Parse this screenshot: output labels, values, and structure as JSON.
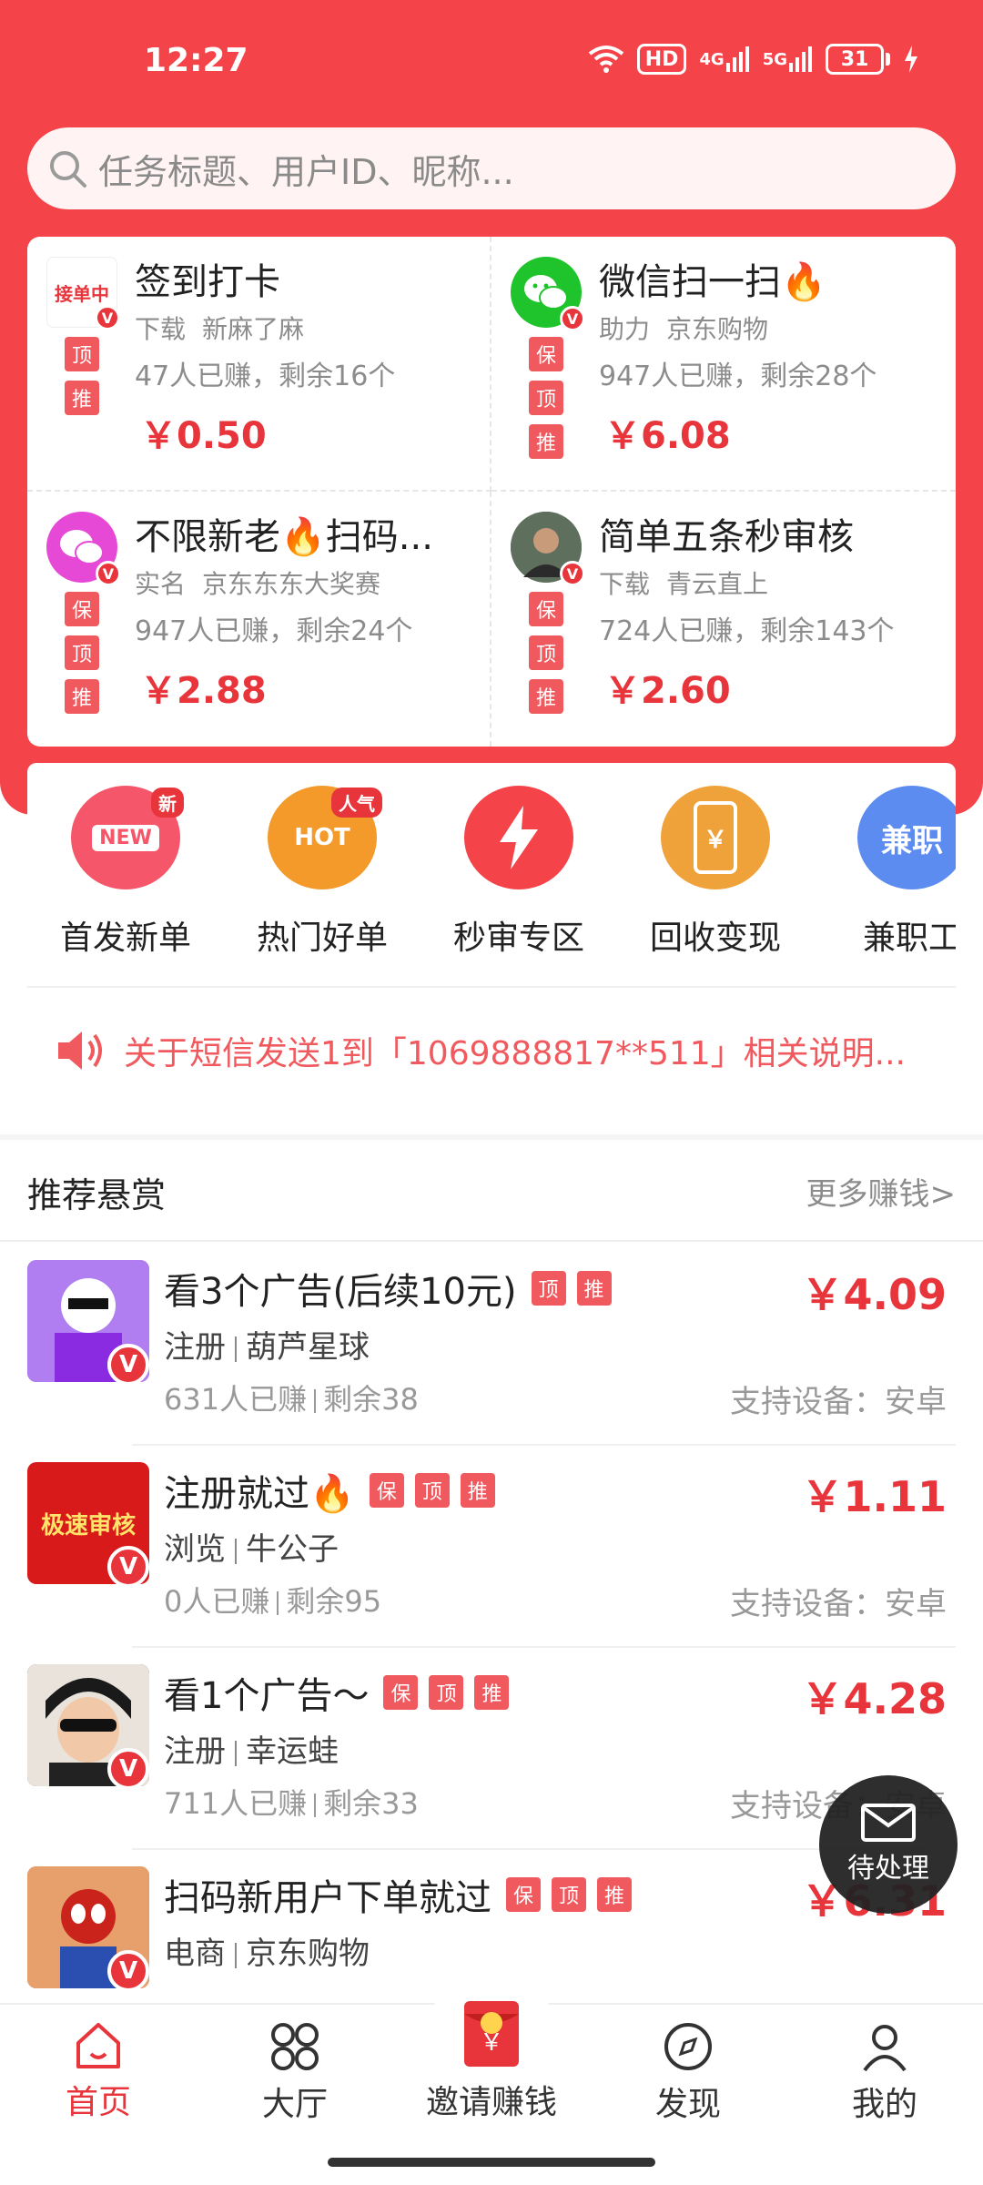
{
  "status": {
    "time": "12:27",
    "hd": "HD",
    "net1": "4G",
    "net2": "5G",
    "battery": "31"
  },
  "search": {
    "placeholder": "任务标题、用户ID、昵称..."
  },
  "top_tasks": [
    {
      "title": "签到打卡",
      "type": "下载",
      "user": "新麻了麻",
      "count": "47人已赚，剩余16个",
      "price": "￥0.50",
      "tags": [
        "顶",
        "推"
      ],
      "avatar_text": "接单中"
    },
    {
      "title": "微信扫一扫🔥",
      "type": "助力",
      "user": "京东购物",
      "count": "947人已赚，剩余28个",
      "price": "￥6.08",
      "tags": [
        "保",
        "顶",
        "推"
      ]
    },
    {
      "title": "不限新老🔥扫码...",
      "type": "实名",
      "user": "京东东东大奖赛",
      "count": "947人已赚，剩余24个",
      "price": "￥2.88",
      "tags": [
        "保",
        "顶",
        "推"
      ]
    },
    {
      "title": "简单五条秒审核",
      "type": "下载",
      "user": "青云直上",
      "count": "724人已赚，剩余143个",
      "price": "￥2.60",
      "tags": [
        "保",
        "顶",
        "推"
      ]
    }
  ],
  "categories": [
    {
      "label": "首发新单",
      "badge": "新",
      "icon_text": "NEW",
      "color": "#f5566a"
    },
    {
      "label": "热门好单",
      "badge": "人气",
      "icon_text": "HOT",
      "color": "#f39a2b"
    },
    {
      "label": "秒审专区",
      "icon_text": "",
      "color": "#f5434a"
    },
    {
      "label": "回收变现",
      "icon_text": "￥",
      "color": "#f0a23a"
    },
    {
      "label": "兼职工",
      "icon_text": "兼职",
      "color": "#5d8cf0"
    }
  ],
  "notice": {
    "text": "关于短信发送1到「1069888817**511」相关说明..."
  },
  "section": {
    "title": "推荐悬赏",
    "more": "更多赚钱>"
  },
  "rec_items": [
    {
      "title": "看3个广告(后续10元)",
      "tags": [
        "顶",
        "推"
      ],
      "price": "￥4.09",
      "category": "注册",
      "user": "葫芦星球",
      "earned": "631人已赚",
      "remaining": "剩余38",
      "device": "支持设备：安卓",
      "thumb_color": "#8a3ad8"
    },
    {
      "title": "注册就过🔥",
      "tags": [
        "保",
        "顶",
        "推"
      ],
      "price": "￥1.11",
      "category": "浏览",
      "user": "牛公子",
      "earned": "0人已赚",
      "remaining": "剩余95",
      "device": "支持设备：安卓",
      "thumb_color": "#d91a1a",
      "thumb_text": "极速审核"
    },
    {
      "title": "看1个广告～",
      "tags": [
        "保",
        "顶",
        "推"
      ],
      "price": "￥4.28",
      "category": "注册",
      "user": "幸运蛙",
      "earned": "711人已赚",
      "remaining": "剩余33",
      "device": "支持设备：安卓",
      "thumb_color": "#3b3b3b"
    },
    {
      "title": "扫码新用户下单就过",
      "tags": [
        "保",
        "顶",
        "推"
      ],
      "price": "￥6.31",
      "category": "电商",
      "user": "京东购物",
      "earned": "",
      "remaining": "",
      "device": "",
      "thumb_color": "#c94b35"
    }
  ],
  "pending": {
    "label": "待处理"
  },
  "nav": [
    {
      "label": "首页",
      "active": true
    },
    {
      "label": "大厅"
    },
    {
      "label": "邀请赚钱"
    },
    {
      "label": "发现"
    },
    {
      "label": "我的"
    }
  ],
  "colors": {
    "primary": "#f5434a",
    "price": "#e8343b",
    "tag": "#f05a5f"
  }
}
